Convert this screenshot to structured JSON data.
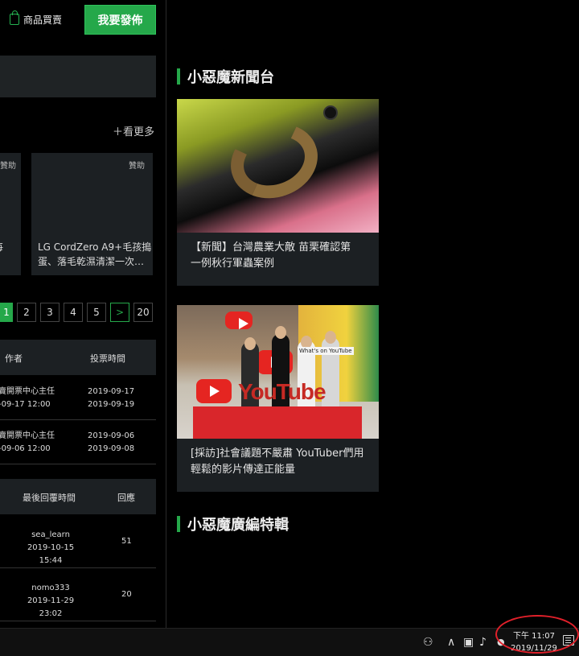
{
  "header": {
    "shop_label": "商品買賣",
    "publish_label": "我要發佈"
  },
  "left": {
    "see_more": "＋看更多",
    "card_a": {
      "sponsor": "贊助",
      "line1": "賽每",
      "line2": "…"
    },
    "card_b": {
      "sponsor": "贊助",
      "line1": "LG CordZero A9+毛孩搗",
      "line2": "蛋、落毛乾濕清潔一次…"
    },
    "pager": [
      "1",
      "2",
      "3",
      "4",
      "5",
      ">",
      "20"
    ],
    "vote_table": {
      "headers": {
        "author": "作者",
        "time": "投票時間"
      },
      "rows": [
        {
          "author1": "賣開票中心主任",
          "author2": "-09-17 12:00",
          "time1": "2019-09-17",
          "time2": "2019-09-19"
        },
        {
          "author1": "賣開票中心主任",
          "author2": "-09-06 12:00",
          "time1": "2019-09-06",
          "time2": "2019-09-08"
        }
      ]
    },
    "reply_table": {
      "headers": {
        "last_reply": "最後回覆時間",
        "replies": "回應"
      },
      "rows": [
        {
          "user": "sea_learn",
          "time": "2019-10-15 15:44",
          "count": "51"
        },
        {
          "user": "nomo333",
          "time": "2019-11-29 23:02",
          "count": "20"
        }
      ]
    }
  },
  "right": {
    "news_title": "小惡魔新聞台",
    "news": [
      {
        "line1": "【新聞】台灣農業大敵 苗栗確認第",
        "line2": "一例秋行軍蟲案例"
      },
      {
        "line1": "[採訪]社會議題不嚴肅 YouTuber們用",
        "line2": "輕鬆的影片傳達正能量"
      }
    ],
    "ad_title": "小惡魔廣編特輯"
  },
  "image_text": {
    "youtube": "YouTube",
    "sign": "What's on YouTube"
  },
  "taskbar": {
    "time": "下午 11:07",
    "date": "2019/11/29"
  },
  "colors": {
    "accent": "#25a84a",
    "highlight_ring": "#e0202a"
  }
}
